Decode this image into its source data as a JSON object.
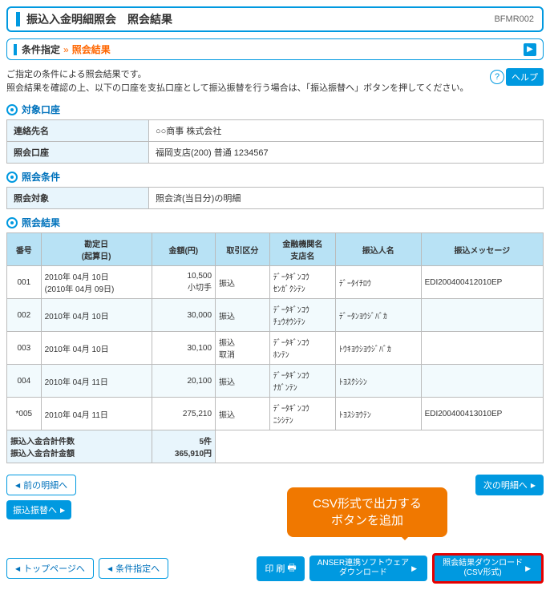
{
  "header": {
    "title": "振込入金明細照会　照会結果",
    "code": "BFMR002"
  },
  "breadcrumb": {
    "step1": "条件指定",
    "step2": "照会結果"
  },
  "description": {
    "line1": "ご指定の条件による照会結果です。",
    "line2": "照会結果を確認の上、以下の口座を支払口座として振込振替を行う場合は、「振込振替へ」ボタンを押してください。"
  },
  "help_label": "ヘルプ",
  "sections": {
    "account": "対象口座",
    "conditions": "照会条件",
    "result": "照会結果"
  },
  "account_table": {
    "contact_label": "連絡先名",
    "contact_value": "○○商事 株式会社",
    "account_label": "照会口座",
    "account_value": "福岡支店(200) 普通 1234567"
  },
  "conditions_table": {
    "target_label": "照会対象",
    "target_value": "照会済(当日分)の明細"
  },
  "result_headers": {
    "no": "番号",
    "date": "勘定日\n(起算日)",
    "amount": "金額(円)",
    "type": "取引区分",
    "bank": "金融機関名\n支店名",
    "payer": "振込人名",
    "message": "振込メッセージ"
  },
  "rows": [
    {
      "no": "001",
      "date": "2010年 04月 10日\n(2010年 04月 09日)",
      "amount": "10,500\n小切手",
      "type": "振込",
      "bank": "ﾃﾞｰﾀｷﾞﾝｺｳ\nｾﾝｶﾞｸｼﾃﾝ",
      "payer": "ﾃﾞｰﾀｲﾁﾛｳ",
      "msg": "EDI200400412010EP"
    },
    {
      "no": "002",
      "date": "2010年 04月 10日",
      "amount": "30,000",
      "type": "振込",
      "bank": "ﾃﾞｰﾀｷﾞﾝｺｳ\nﾁｭｳｵｳｼﾃﾝ",
      "payer": "ﾃﾞｰﾀﾝﾖｳｼﾞﾊﾞｶ",
      "msg": ""
    },
    {
      "no": "003",
      "date": "2010年 04月 10日",
      "amount": "30,100",
      "type": "振込\n取消",
      "bank": "ﾃﾞｰﾀｷﾞﾝｺｳ\nﾎﾝﾃﾝ",
      "payer": "ﾄｳｷﾖｳｼﾖｳｼﾞﾊﾞｶ",
      "msg": ""
    },
    {
      "no": "004",
      "date": "2010年 04月 11日",
      "amount": "20,100",
      "type": "振込",
      "bank": "ﾃﾞｰﾀｷﾞﾝｺｳ\nﾅｶﾞﾝﾃﾝ",
      "payer": "ﾄﾖｽｸｼｼﾝ",
      "msg": ""
    },
    {
      "no": "*005",
      "date": "2010年 04月 11日",
      "amount": "275,210",
      "type": "振込",
      "bank": "ﾃﾞｰﾀｷﾞﾝｺｳ\nﾆｼｼﾃﾝ",
      "payer": "ﾄﾖｽｼﾖｳﾃﾝ",
      "msg": "EDI200400413010EP"
    }
  ],
  "summary": {
    "count_label": "振込入金合計件数",
    "amount_label": "振込入金合計金額",
    "count_value": "5件",
    "amount_value": "365,910円"
  },
  "buttons": {
    "prev": "前の明細へ",
    "next": "次の明細へ",
    "transfer": "振込振替へ",
    "top": "トップページへ",
    "back_cond": "条件指定へ",
    "print": "印 刷",
    "anser": "ANSER連携ソフトウェア\nダウンロード",
    "csv": "照会結果ダウンロード\n(CSV形式)"
  },
  "callout": "CSV形式で出力する\nボタンを追加"
}
